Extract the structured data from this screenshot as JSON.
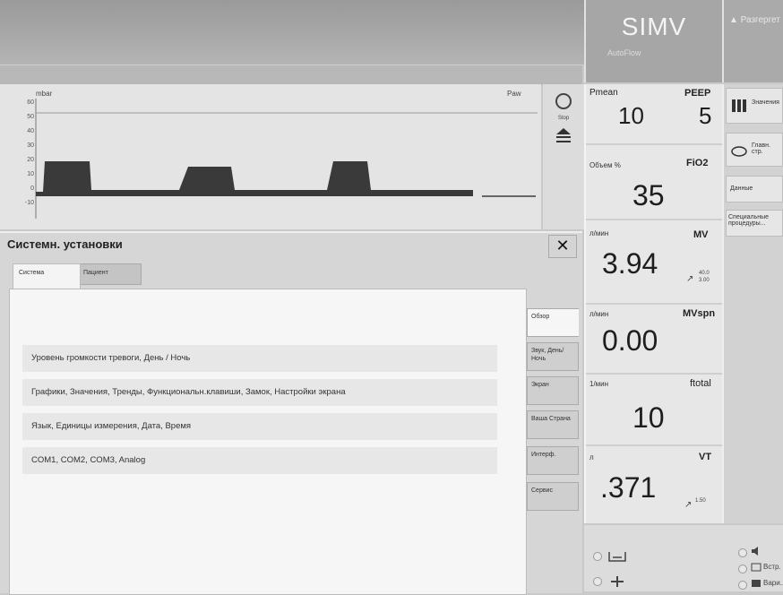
{
  "header": {
    "mode": "SIMV",
    "mode_sub": "AutoFlow",
    "alarm_text": "▲ Разгергет"
  },
  "waveform": {
    "unit": "mbar",
    "label": "Paw",
    "y_ticks": [
      "60",
      "50",
      "40",
      "30",
      "20",
      "10",
      "0",
      "-10"
    ],
    "tool1_icon": "freeze-icon",
    "tool1_label": "Stop",
    "tool2_icon": "curve-select-icon"
  },
  "measurements": {
    "pmean": {
      "label": "Pmean",
      "value": "10"
    },
    "peep": {
      "label": "PEEP",
      "value": "5"
    },
    "fio2": {
      "label": "FiO2",
      "sub": "Объем %",
      "value": "35"
    },
    "mv": {
      "label": "MV",
      "sub": "л/мин",
      "value": "3.94",
      "hi": "40.0",
      "lo": "3.00"
    },
    "mvspn": {
      "label": "MVspn",
      "sub": "л/мин",
      "value": "0.00"
    },
    "ftotal": {
      "label": "ftotal",
      "sub": "1/мин",
      "value": "10"
    },
    "vt": {
      "label": "VT",
      "sub": "л",
      "value": ".371",
      "lim": "1.50"
    }
  },
  "side_menu": {
    "values": "Значения",
    "main": "Главн. стр.",
    "data": "Данные",
    "special": "Специальные процедуры..."
  },
  "dialog": {
    "title": "Системн. установки",
    "close": "✕",
    "tabs": [
      "Система",
      "Пациент"
    ],
    "rows": [
      "Уровень громкости тревоги, День / Ночь",
      "Графики, Значения, Тренды, Функциональн.клавиши, Замок, Настройки экрана",
      "Язык, Единицы измерения, Дата, Время",
      "COM1, COM2, COM3, Analog"
    ],
    "vtabs": [
      "Обзор",
      "Звук, День/Ночь",
      "Экран",
      "Ваша Страна",
      "Интерф.",
      "Сервис"
    ]
  },
  "bottom": {
    "item1": "Встр.",
    "item2": "Вари..."
  }
}
